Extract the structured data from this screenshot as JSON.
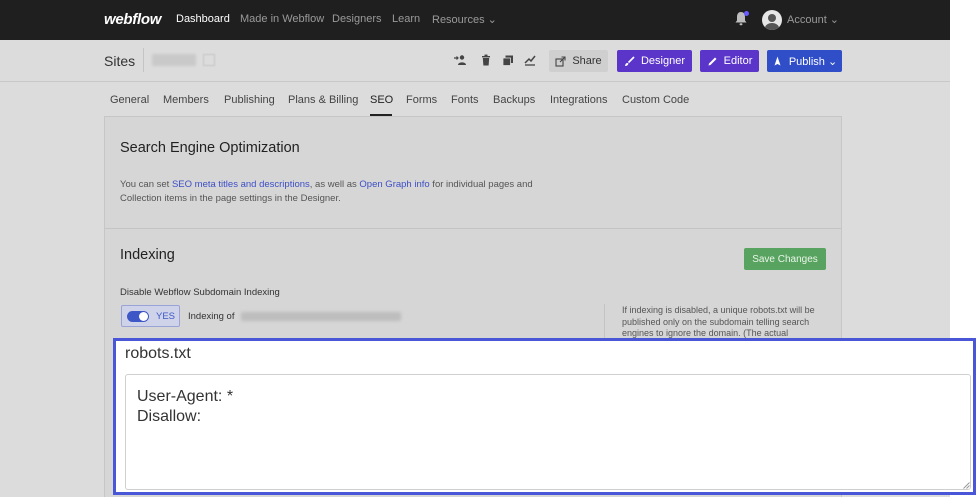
{
  "topnav": {
    "logo": "webflow",
    "links": [
      "Dashboard",
      "Made in Webflow",
      "Designers",
      "Learn",
      "Resources ⌄"
    ],
    "account": "Account ⌄"
  },
  "sitesbar": {
    "title": "Sites",
    "share": "Share",
    "designer": "Designer",
    "editor": "Editor",
    "publish": "Publish ⌄"
  },
  "tabs": [
    "General",
    "Members",
    "Publishing",
    "Plans & Billing",
    "SEO",
    "Forms",
    "Fonts",
    "Backups",
    "Integrations",
    "Custom Code"
  ],
  "active_tab": "SEO",
  "seo": {
    "title": "Search Engine Optimization",
    "text_1": "You can set ",
    "link_1": "SEO meta titles and descriptions",
    "text_2": ", as well as ",
    "link_2": "Open Graph info",
    "text_3": " for individual pages and Collection items in the page settings in the Designer."
  },
  "indexing": {
    "title": "Indexing",
    "save": "Save Changes",
    "disable_label": "Disable Webflow Subdomain Indexing",
    "toggle": "YES",
    "indexing_of": "Indexing of",
    "note": "If indexing is disabled, a unique robots.txt will be published only on the subdomain telling search engines to ignore the domain. (The actual"
  },
  "robots": {
    "title": "robots.txt",
    "content": "User-Agent: *\nDisallow:"
  }
}
